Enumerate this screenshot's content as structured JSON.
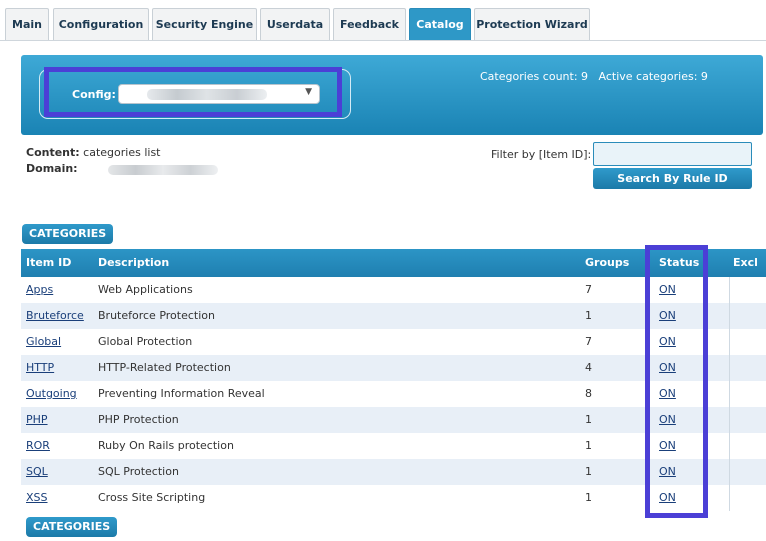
{
  "tabs": [
    {
      "label": "Main",
      "active": false
    },
    {
      "label": "Configuration",
      "active": false
    },
    {
      "label": "Security Engine",
      "active": false
    },
    {
      "label": "Userdata",
      "active": false
    },
    {
      "label": "Feedback",
      "active": false
    },
    {
      "label": "Catalog",
      "active": true
    },
    {
      "label": "Protection Wizard",
      "active": false
    }
  ],
  "config": {
    "label": "Config:",
    "caret": "▼"
  },
  "counts": {
    "categories_label": "Categories count:",
    "categories_value": "9",
    "active_label": "Active categories:",
    "active_value": "9"
  },
  "content": {
    "label": "Content:",
    "value": "categories list"
  },
  "domain": {
    "label": "Domain:"
  },
  "filter": {
    "label": "Filter by [Item ID]:",
    "value": "",
    "button": "Search By Rule ID"
  },
  "categories_button": "CATEGORIES",
  "table": {
    "headers": {
      "item_id": "Item ID",
      "description": "Description",
      "groups": "Groups",
      "status": "Status",
      "excl": "Excl"
    },
    "rows": [
      {
        "id": "Apps",
        "description": "Web Applications",
        "groups": "7",
        "status": "ON"
      },
      {
        "id": "Bruteforce",
        "description": "Bruteforce Protection",
        "groups": "1",
        "status": "ON"
      },
      {
        "id": "Global",
        "description": "Global Protection",
        "groups": "7",
        "status": "ON"
      },
      {
        "id": "HTTP",
        "description": "HTTP-Related Protection",
        "groups": "4",
        "status": "ON"
      },
      {
        "id": "Outgoing",
        "description": "Preventing Information Reveal",
        "groups": "8",
        "status": "ON"
      },
      {
        "id": "PHP",
        "description": "PHP Protection",
        "groups": "1",
        "status": "ON"
      },
      {
        "id": "ROR",
        "description": "Ruby On Rails protection",
        "groups": "1",
        "status": "ON"
      },
      {
        "id": "SQL",
        "description": "SQL Protection",
        "groups": "1",
        "status": "ON"
      },
      {
        "id": "XSS",
        "description": "Cross Site Scripting",
        "groups": "1",
        "status": "ON"
      }
    ]
  },
  "colors": {
    "accent": "#2e98c7",
    "highlight": "#4b3fd6",
    "row_alt": "#e8eff7"
  }
}
